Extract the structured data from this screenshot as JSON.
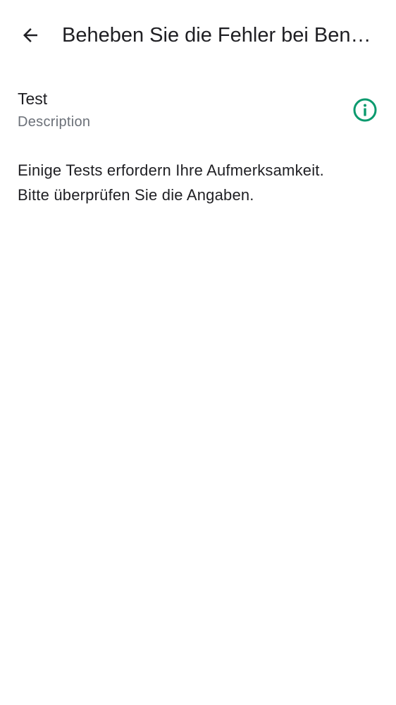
{
  "header": {
    "title": "Beheben Sie die Fehler bei Benutzerkonten",
    "back_icon": "arrow-back-icon"
  },
  "test_item": {
    "title": "Test",
    "description": "Description",
    "info_icon": "info-icon",
    "accent_color": "#0a9a6e"
  },
  "message": {
    "line1": "Einige Tests erfordern Ihre Aufmerksamkeit.",
    "line2": "Bitte überprüfen Sie die Angaben."
  }
}
